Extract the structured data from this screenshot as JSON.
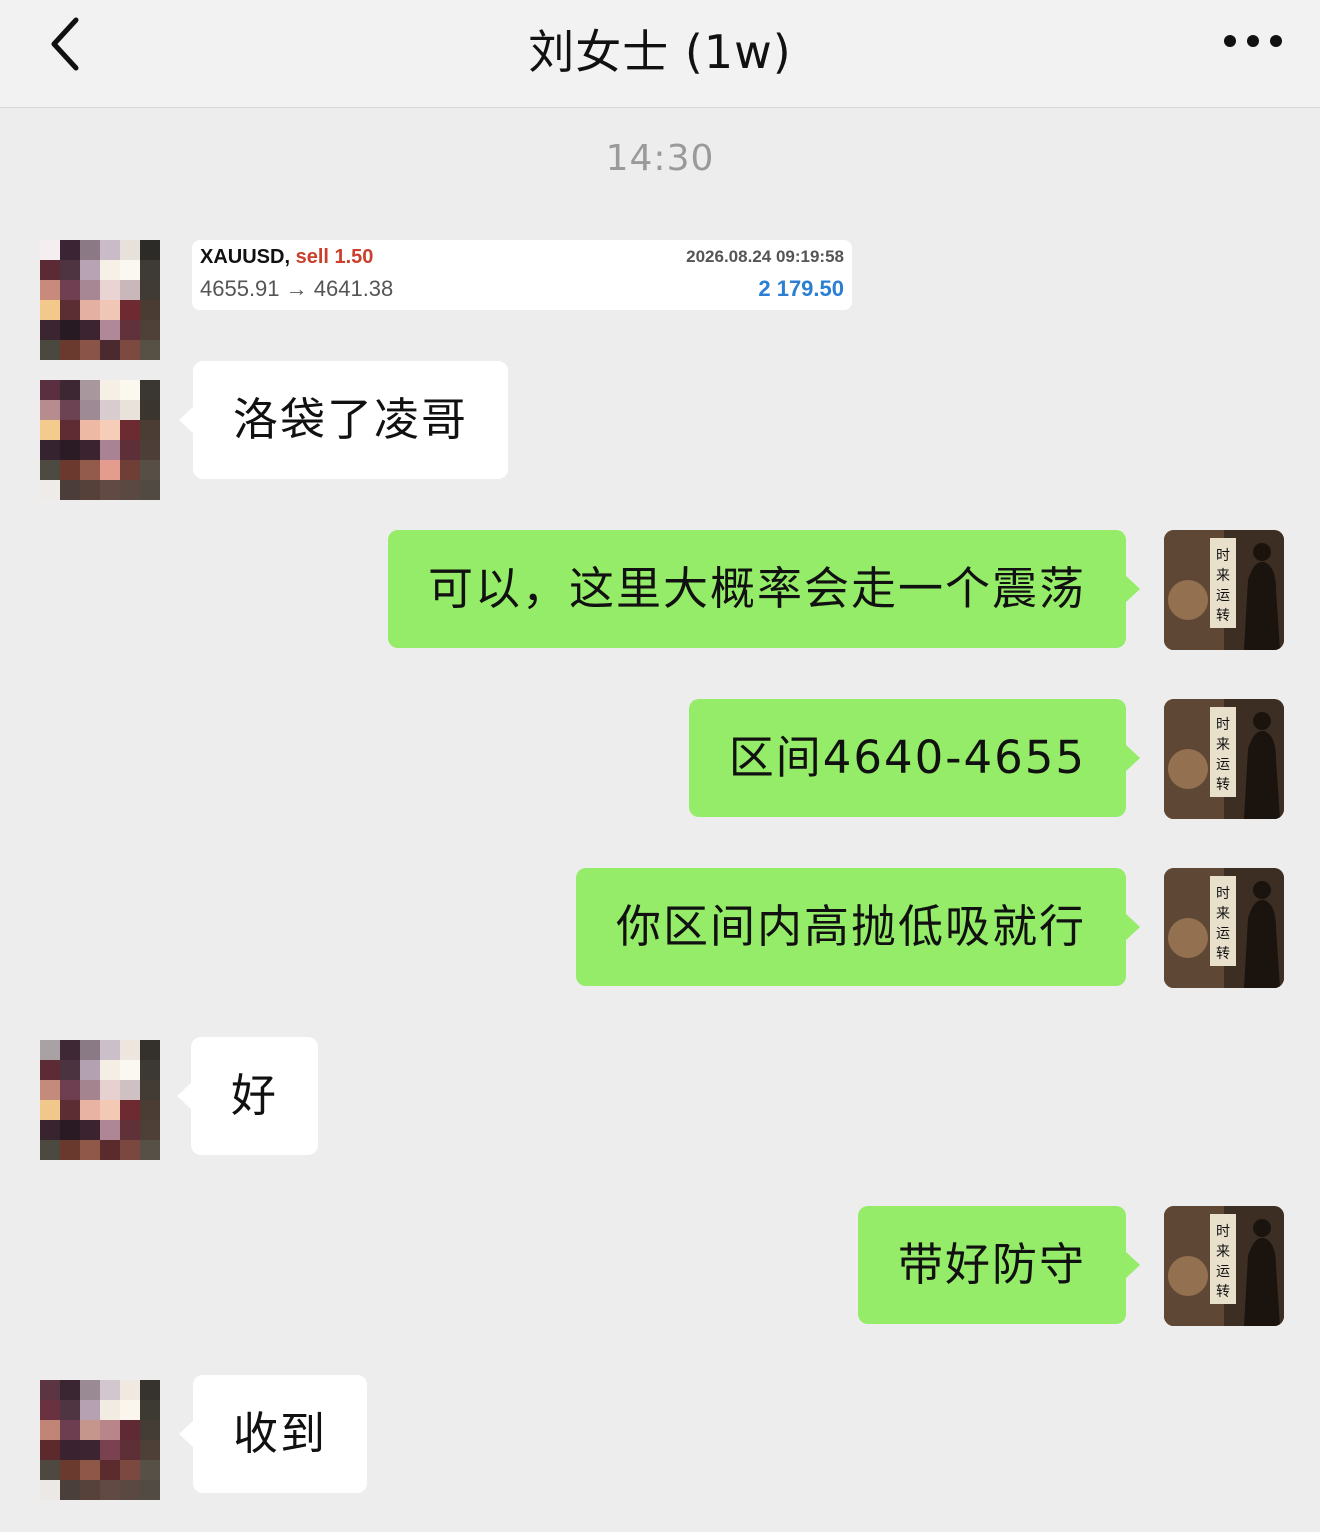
{
  "header": {
    "title": "刘女士 (1w)",
    "back_icon": "chevron-left-icon",
    "more_icon": "more-dots-icon"
  },
  "timestamp": "14:30",
  "trade_card": {
    "symbol": "XAUUSD,",
    "side": "sell 1.50",
    "datetime": "2026.08.24 09:19:58",
    "prices": "4655.91 → 4641.38",
    "profit": "2 179.50"
  },
  "messages": [
    {
      "from": "them",
      "text": "洛袋了凌哥"
    },
    {
      "from": "me",
      "text": "可以，这里大概率会走一个震荡"
    },
    {
      "from": "me",
      "text": "区间4640-4655"
    },
    {
      "from": "me",
      "text": "你区间内高抛低吸就行"
    },
    {
      "from": "them",
      "text": "好"
    },
    {
      "from": "me",
      "text": "带好防守"
    },
    {
      "from": "them",
      "text": "收到"
    }
  ],
  "colors": {
    "background": "#ededed",
    "bubble_outgoing": "#95ec69",
    "bubble_incoming": "#ffffff",
    "sell": "#c9402c",
    "profit": "#2b7ed1"
  }
}
